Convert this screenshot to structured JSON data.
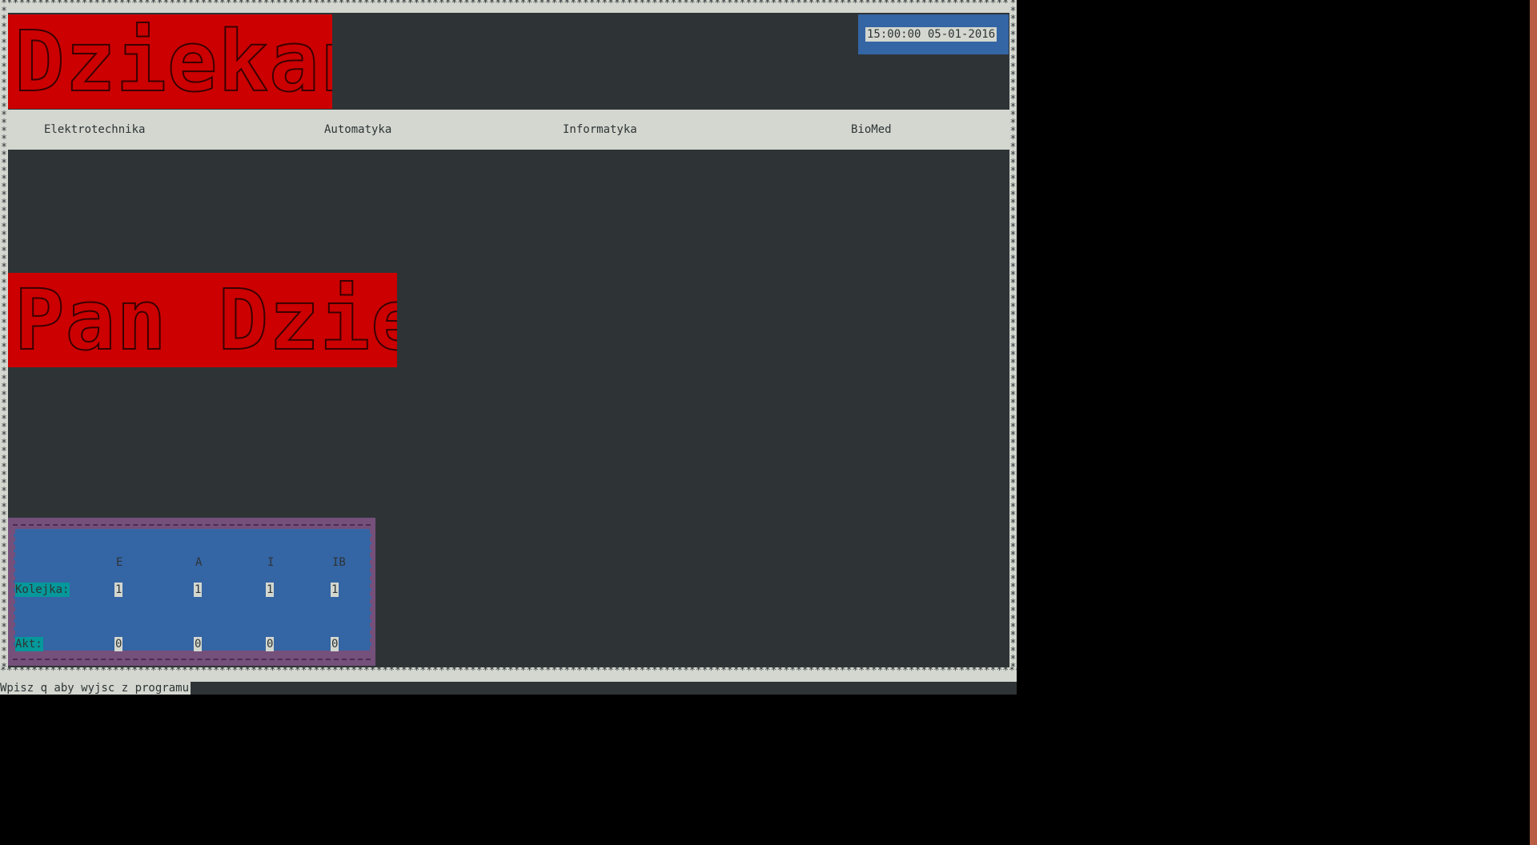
{
  "border": {
    "char": "*"
  },
  "logo_banner": {
    "text": "Dziekanat"
  },
  "name_banner": {
    "text": "Pan Dziekan"
  },
  "clock": {
    "value": "15:00:00 05-01-2016"
  },
  "menu": {
    "items": [
      {
        "label": "Elektrotechnika"
      },
      {
        "label": "Automatyka"
      },
      {
        "label": "Informatyka"
      },
      {
        "label": "BioMed"
      }
    ]
  },
  "stats": {
    "columns": [
      "E",
      "A",
      "I",
      "IB"
    ],
    "queue": {
      "label": "Kolejka:",
      "values": [
        "1",
        "1",
        "1",
        "1"
      ]
    },
    "current": {
      "label": "Akt:",
      "values": [
        "0",
        "0",
        "0",
        "0"
      ]
    }
  },
  "status": {
    "text": "Wpisz q aby wyjsc z programu"
  },
  "colors": {
    "terminal_bg": "#2e3436",
    "red_banner": "#cc0000",
    "blue_panel": "#3465a4",
    "purple_panel": "#75507b",
    "cyan_label": "#06989a",
    "light_gray": "#d3d7cf"
  }
}
